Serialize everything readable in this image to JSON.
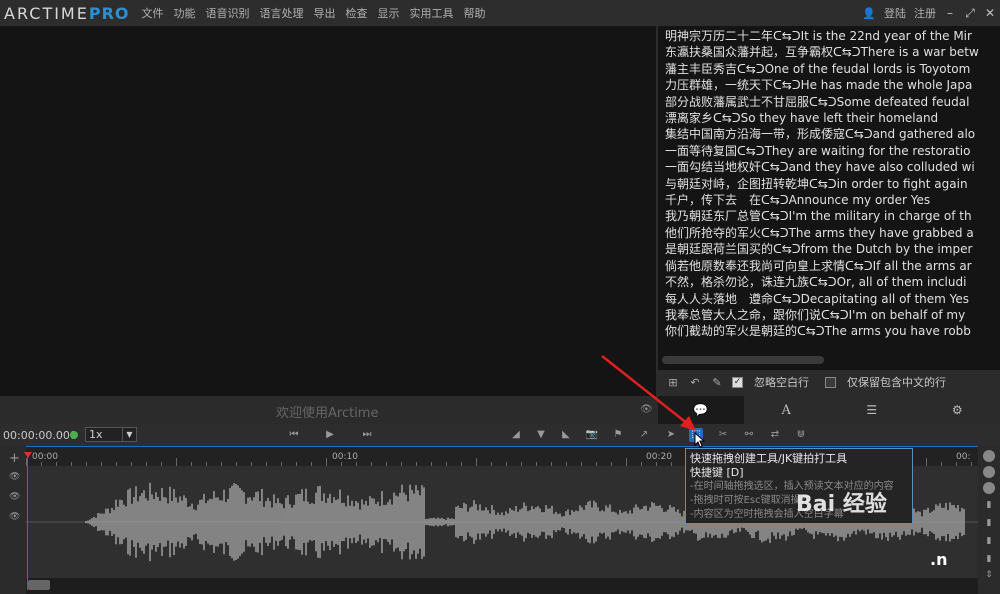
{
  "app": {
    "logo_main": "ARCTIME",
    "logo_pro": "PRO",
    "menu": [
      "文件",
      "功能",
      "语音识别",
      "语言处理",
      "导出",
      "检查",
      "显示",
      "实用工具",
      "帮助"
    ],
    "login": "登陆",
    "register": "注册"
  },
  "video": {
    "welcome": "欢迎使用Arctime"
  },
  "subtitles": [
    "明神宗万历二十二年ᑕ⇆ᑐIt is the 22nd year of the Mir",
    "东瀛扶桑国众藩并起，互争霸权ᑕ⇆ᑐThere is a war betw",
    "藩主丰臣秀吉ᑕ⇆ᑐOne of the feudal lords is Toyotom",
    "力压群雄，一统天下ᑕ⇆ᑐHe has made the whole Japa",
    "部分战败藩属武士不甘屈服ᑕ⇆ᑐSome defeated feudal",
    "漂离家乡ᑕ⇆ᑐSo they have left their homeland",
    "集结中国南方沿海一带，形成倭寇ᑕ⇆ᑐand gathered alo",
    "一面等待复国ᑕ⇆ᑐThey are waiting for the restoratio",
    "一面勾结当地权奸ᑕ⇆ᑐand they have also colluded wi",
    "与朝廷对峙，企图扭转乾坤ᑕ⇆ᑐin order to fight again",
    "千户，传下去　在ᑕ⇆ᑐAnnounce my order Yes",
    "我乃朝廷东厂总管ᑕ⇆ᑐI'm the military in charge of th",
    "他们所抢夺的军火ᑕ⇆ᑐThe arms they have grabbed a",
    "是朝廷跟荷兰国买的ᑕ⇆ᑐfrom the Dutch by the imper",
    "倘若他原数奉还我尚可向皇上求情ᑕ⇆ᑐIf all the arms ar",
    "不然，格杀勿论，诛连九族ᑕ⇆ᑐOr, all of them includi",
    "每人人头落地　遵命ᑕ⇆ᑐDecapitating all of them Yes",
    "我奉总管大人之命，跟你们说ᑕ⇆ᑐI'm on behalf of my",
    "你们截劫的军火是朝廷的ᑕ⇆ᑐThe arms you have robb"
  ],
  "sub_toolbar": {
    "ignore_blank": "忽略空白行",
    "keep_chinese": "仅保留包含中文的行",
    "ignore_blank_checked": true,
    "keep_chinese_checked": false
  },
  "tabs": [
    {
      "name": "tab-subtitles",
      "icon": "speech-bubble-icon",
      "glyph": "💬"
    },
    {
      "name": "tab-font",
      "icon": "font-icon",
      "glyph": "A"
    },
    {
      "name": "tab-list",
      "icon": "list-icon",
      "glyph": "☰"
    },
    {
      "name": "tab-settings",
      "icon": "gear-icon",
      "glyph": "⚙"
    }
  ],
  "transport": {
    "time": "00:00:00.000",
    "speed": "1x"
  },
  "ruler": {
    "labels": [
      "00:00",
      "00:10",
      "00:20",
      "00:"
    ]
  },
  "tooltip": {
    "title": "快速拖拽创建工具/JK键拍打工具",
    "shortcut": "快捷键 [D]",
    "lines": [
      "-在时间轴拖拽选区，插入预读文本对应的内容",
      "-拖拽时可按Esc键取消操作",
      "-内容区为空时拖拽会插入空白字幕"
    ]
  },
  "watermark": "Bai 经验",
  "watermark_n": ".n",
  "colors": {
    "accent": "#1e6fc0",
    "brand_pro": "#2e8fd0",
    "annotation_arrow": "#e02020",
    "status_green": "#4caf50"
  }
}
